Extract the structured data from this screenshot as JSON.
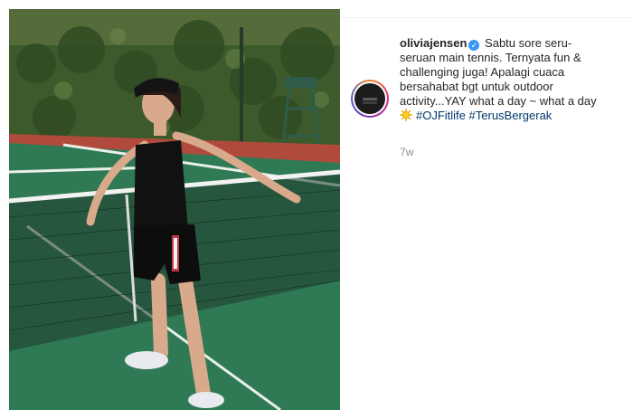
{
  "post": {
    "username": "oliviajensen",
    "caption": "Sabtu sore seru-seruan main tennis. Ternyata fun & challenging juga! Apalagi cuaca bersahabat bgt untuk outdoor activity...YAY what a day ~ what a day",
    "hashtags": [
      "#OJFitlife",
      "#TerusBergerak"
    ],
    "timestamp": "7w"
  },
  "icons": {
    "verified": "verified-badge-icon",
    "emoji": "sun-emoji-icon"
  },
  "colors": {
    "hashtag": "#00376b",
    "verified": "#3897f0",
    "timestamp": "#8e8e8e"
  }
}
